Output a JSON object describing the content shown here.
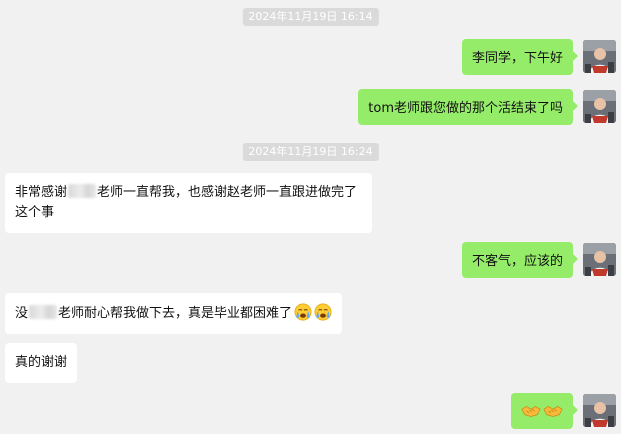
{
  "timestamps": {
    "first": "2024年11月19日 16:14",
    "second": "2024年11月19日 16:24"
  },
  "messages": {
    "greeting": "李同学，下午好",
    "tom_question": "tom老师跟您做的那个活结束了吗",
    "thanks_part1": "非常感谢",
    "thanks_part2": "老师一直帮我，也感谢赵老师一直跟进做完了这个事",
    "reply_welcome": "不客气，应该的",
    "hard_part1": "没",
    "hard_part2": "老师耐心帮我做下去，真是毕业都困难了",
    "thank_you": "真的谢谢"
  },
  "icons": {
    "crying_emoji": "loudly-crying-face-icon",
    "handshake_emoji": "handshake-icon",
    "avatar": "user-avatar-icon"
  },
  "colors": {
    "outgoing_bubble": "#95ec69",
    "incoming_bubble": "#ffffff",
    "background": "#f1f1f1",
    "timestamp_bg": "#dadada"
  }
}
